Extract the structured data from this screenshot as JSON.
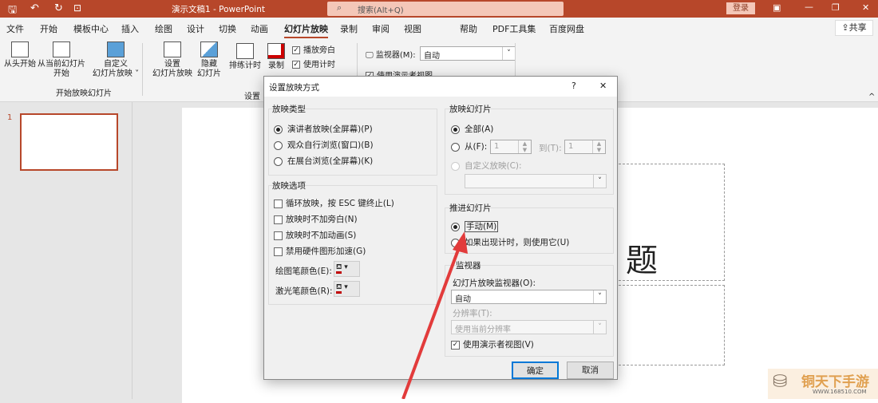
{
  "app": {
    "title": "演示文稿1 - PowerPoint",
    "search_placeholder": "搜索(Alt+Q)",
    "login": "登录",
    "share": "共享",
    "accent": "#b7472a"
  },
  "tabs": [
    "文件",
    "开始",
    "模板中心",
    "插入",
    "绘图",
    "设计",
    "切换",
    "动画",
    "幻灯片放映",
    "录制",
    "审阅",
    "视图",
    "帮助",
    "PDF工具集",
    "百度网盘"
  ],
  "active_tab": "幻灯片放映",
  "ribbon": {
    "from_start": "从头开始",
    "from_current_1": "从当前幻灯片",
    "from_current_2": "开始",
    "custom_1": "自定义",
    "custom_2": "幻灯片放映 ˅",
    "group_start": "开始放映幻灯片",
    "setup_1": "设置",
    "setup_2": "幻灯片放映",
    "hide_1": "隐藏",
    "hide_2": "幻灯片",
    "rehearse": "排练计时",
    "record": "录制",
    "play_narration": "播放旁白",
    "use_timings": "使用计时",
    "group_setup": "设置",
    "monitor_label": "监视器(M):",
    "monitor_value": "自动",
    "presenter_view": "使用演示者视图"
  },
  "thumbs": {
    "slide_number": "1"
  },
  "slide": {
    "title_fragment": "题"
  },
  "dialog": {
    "title": "设置放映方式",
    "help": "?",
    "close": "✕",
    "show_type": {
      "label": "放映类型",
      "options": [
        "演讲者放映(全屏幕)(P)",
        "观众自行浏览(窗口)(B)",
        "在展台浏览(全屏幕)(K)"
      ],
      "selected": 0
    },
    "show_options": {
      "label": "放映选项",
      "options": [
        "循环放映，按 ESC 键终止(L)",
        "放映时不加旁白(N)",
        "放映时不加动画(S)",
        "禁用硬件图形加速(G)"
      ],
      "pen_color": "绘图笔颜色(E):",
      "laser_color": "激光笔颜色(R):",
      "pen_hex": "#c00000"
    },
    "show_slides": {
      "label": "放映幻灯片",
      "all": "全部(A)",
      "from": "从(F):",
      "from_value": "1",
      "to": "到(T):",
      "to_value": "1",
      "custom": "自定义放映(C):"
    },
    "advance": {
      "label": "推进幻灯片",
      "manual": "手动(M)",
      "timings": "如果出现计时，则使用它(U)"
    },
    "monitors": {
      "label": "监视器",
      "monitor_label": "幻灯片放映监视器(O):",
      "monitor_value": "自动",
      "resolution_label": "分辨率(T):",
      "resolution_value": "使用当前分辨率",
      "presenter_view": "使用演示者视图(V)"
    },
    "ok": "确定",
    "cancel": "取消"
  },
  "watermark": {
    "name": "铜天下手游",
    "url": "WWW.168510.COM"
  }
}
